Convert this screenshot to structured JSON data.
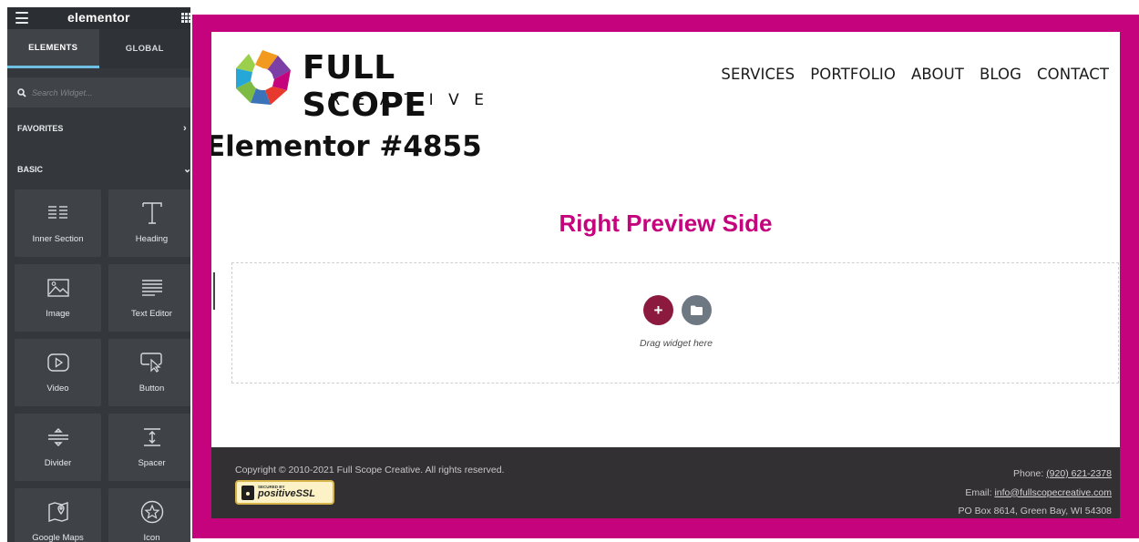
{
  "panel": {
    "brand": "elementor",
    "tabs": [
      {
        "label": "ELEMENTS"
      },
      {
        "label": "GLOBAL"
      }
    ],
    "search": {
      "placeholder": "Search Widget..."
    },
    "categories": {
      "favorites": "FAVORITES",
      "basic": "BASIC"
    },
    "widgets": [
      {
        "label": "Inner Section",
        "icon": "inner-section-icon"
      },
      {
        "label": "Heading",
        "icon": "heading-icon"
      },
      {
        "label": "Image",
        "icon": "image-icon"
      },
      {
        "label": "Text Editor",
        "icon": "text-editor-icon"
      },
      {
        "label": "Video",
        "icon": "video-icon"
      },
      {
        "label": "Button",
        "icon": "button-icon"
      },
      {
        "label": "Divider",
        "icon": "divider-icon"
      },
      {
        "label": "Spacer",
        "icon": "spacer-icon"
      },
      {
        "label": "Google Maps",
        "icon": "google-maps-icon"
      },
      {
        "label": "Icon",
        "icon": "star-icon"
      }
    ]
  },
  "preview": {
    "logo": {
      "line1": "FULL SCOPE",
      "line2": "CREATIVE"
    },
    "nav": [
      "SERVICES",
      "PORTFOLIO",
      "ABOUT",
      "BLOG",
      "CONTACT"
    ],
    "page_title": "Elementor #4855",
    "section_heading": "Right Preview Side",
    "dropzone": {
      "text": "Drag widget here"
    },
    "footer": {
      "copyright": "Copyright © 2010-2021 Full Scope Creative. All rights reserved.",
      "ssl_small": "SECURED BY",
      "ssl_big": "positiveSSL",
      "phone_label": "Phone: ",
      "phone": "(920) 621-2378",
      "email_label": "Email: ",
      "email": "info@fullscopecreative.com",
      "address": "PO Box 8614, Green Bay, WI 54308"
    }
  },
  "colors": {
    "accent": "#c4037d",
    "panel_bg": "#34383c",
    "tab_underline": "#6ec1e4",
    "add_button": "#8b1a3e",
    "template_button": "#6d7882",
    "footer_bg": "#333033"
  }
}
